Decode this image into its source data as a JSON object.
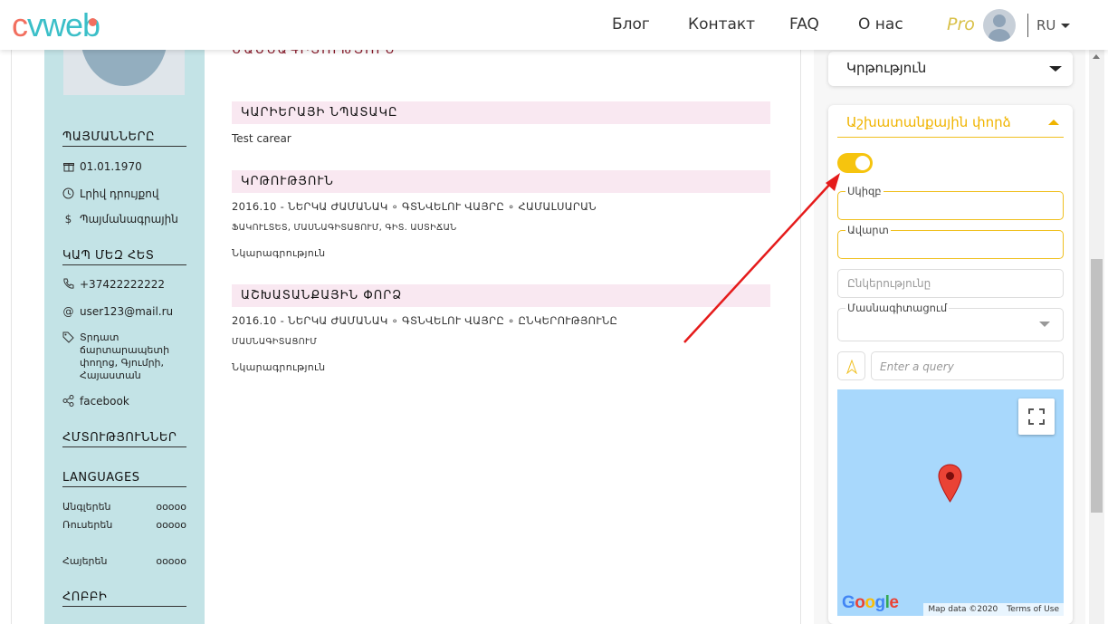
{
  "header": {
    "logo_c": "c",
    "logo_w": "vweb",
    "nav": [
      "Блог",
      "Контакт",
      "FAQ",
      "О нас"
    ],
    "pro": "Pro",
    "language": "RU"
  },
  "resume": {
    "title_cut": "ՄԱՍՆԱԳԻՏՈՒԹՅՈՒՆ",
    "sidebar": {
      "details_head": "ՊԱՅՄԱՆՆԵՐԸ",
      "details": [
        {
          "icon": "gift-icon",
          "text": "01.01.1970"
        },
        {
          "icon": "clock-icon",
          "text": "Լրիվ դրույքով"
        },
        {
          "icon": "dollar-icon",
          "text": "Պայմանագրային"
        }
      ],
      "contact_head": "ԿԱՊ ՄԵԶ ՀԵՏ",
      "contacts": [
        {
          "icon": "phone-icon",
          "text": "+37422222222"
        },
        {
          "icon": "at-icon",
          "text": "user123@mail.ru"
        },
        {
          "icon": "tag-icon",
          "text": "Տրդատ ճարտարապետի փողոց, Գյումրի, Հայաստան"
        },
        {
          "icon": "share-icon",
          "text": "facebook"
        }
      ],
      "skills_head": "ՀՄՏՈՒԹՅՈՒՆՆԵՐ",
      "languages_head": "LANGUAGES",
      "languages": [
        {
          "name": "Անգլերեն",
          "level": "ooooo"
        },
        {
          "name": "Ռուսերեն",
          "level": "ooooo"
        },
        {
          "name": "Հայերեն",
          "level": "ooooo"
        }
      ],
      "hobby_head": "ՀՈԲԲԻ"
    },
    "main": {
      "career_head": "ԿԱՐԻԵՐԱՅԻ ՆՊԱՏԱԿԸ",
      "career_text": "Test carear",
      "education_head": "ԿՐԹՈՒԹՅՈՒՆ",
      "education_line1": "2016.10 - ՆԵՐԿԱ ԺԱՄԱՆԱԿ ∘ ԳՏՆՎԵԼՈՒ ՎԱՅՐԸ ∘ ՀԱՄԱԼՍԱՐԱՆ",
      "education_line2": "ՖԱԿՈՒԼՏԵՏ, ՄԱՍՆԱԳԻՏԱՑՈՒՄ, ԳԻՏ. ԱՍՏԻՃԱՆ",
      "education_desc": "Նկարագրություն",
      "work_head": "ԱՇԽԱՏԱՆՔԱՅԻՆ ՓՈՐՁ",
      "work_line1": "2016.10 - ՆԵՐԿԱ ԺԱՄԱՆԱԿ ∘ ԳՏՆՎԵԼՈՒ ՎԱՅՐԸ ∘ ԸՆԿԵՐՈՒԹՅՈՒՆԸ",
      "work_line2": "ՄԱՍՆԱԳԻՏԱՑՈՒՄ",
      "work_desc": "Նկարագրություն"
    }
  },
  "panel": {
    "education_label": "Կրթություն",
    "work_label": "Աշխատանքային փորձ",
    "toggle_on": true,
    "start_label": "Սկիզբ",
    "end_label": "Ավարտ",
    "company_placeholder": "Ընկերությունը",
    "specialization_label": "Մասնագիտացում",
    "query_placeholder": "Enter a query",
    "map": {
      "google": "Google",
      "attribution": "Map data ©2020",
      "terms": "Terms of Use"
    }
  },
  "colors": {
    "accent": "#f6c40e",
    "sidebar": "#c3e3e6",
    "section_bar": "#f9e8f1",
    "map_water": "#a8d8fc",
    "pin": "#ea4335"
  }
}
